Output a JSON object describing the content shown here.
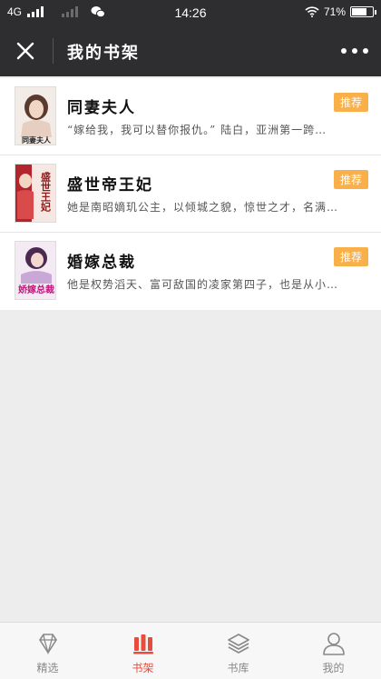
{
  "status_bar": {
    "carrier": "4G",
    "time": "14:26",
    "battery_text": "71%",
    "battery_level": 0.71
  },
  "header": {
    "title": "我的书架"
  },
  "books": [
    {
      "title": "同妻夫人",
      "cover_text": "同妻夫人",
      "description": "“嫁给我，我可以替你报仇。” 陆白，亚洲第一跨…",
      "badge": "推荐"
    },
    {
      "title": "盛世帝王妃",
      "cover_text": "盛世王妃",
      "description": "她是南昭嫡玑公主，以倾城之貌，惊世之才，名满…",
      "badge": "推荐"
    },
    {
      "title": "婚嫁总裁",
      "cover_text": "娇嫁总裁",
      "description": "他是权势滔天、富可敌国的凌家第四子，也是从小…",
      "badge": "推荐"
    }
  ],
  "tabs": [
    {
      "label": "精选",
      "icon": "diamond-icon",
      "active": false
    },
    {
      "label": "书架",
      "icon": "bookshelf-icon",
      "active": true
    },
    {
      "label": "书库",
      "icon": "layers-icon",
      "active": false
    },
    {
      "label": "我的",
      "icon": "user-icon",
      "active": false
    }
  ],
  "colors": {
    "header_bg": "#2e2e31",
    "badge": "#f9b04b",
    "active_tab": "#e84c3d"
  }
}
